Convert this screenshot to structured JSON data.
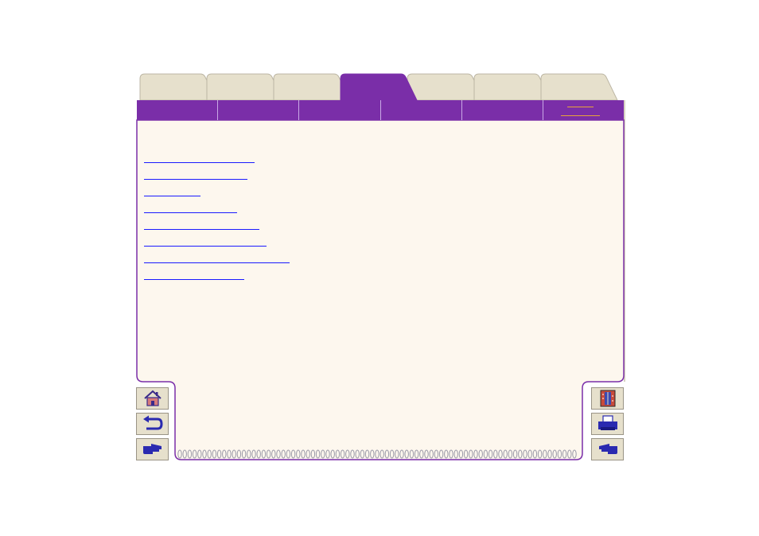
{
  "window": {
    "title": ""
  },
  "tabs": [
    {
      "label": "",
      "active": false
    },
    {
      "label": "",
      "active": false
    },
    {
      "label": "",
      "active": false
    },
    {
      "label": "",
      "active": true
    },
    {
      "label": "",
      "active": false
    },
    {
      "label": "",
      "active": false
    },
    {
      "label": "",
      "active": false
    }
  ],
  "subnav": [
    {
      "label": "",
      "active": false
    },
    {
      "label": "",
      "active": false
    },
    {
      "label": "",
      "active": false
    },
    {
      "label": "",
      "active": false
    },
    {
      "label": "",
      "active": false
    },
    {
      "label": "",
      "active": true
    }
  ],
  "links": [
    {
      "label": "",
      "underline_fraction": 0.76
    },
    {
      "label": "",
      "underline_fraction": 0.71
    },
    {
      "label": "",
      "underline_fraction": 0.39
    },
    {
      "label": "",
      "underline_fraction": 0.64
    },
    {
      "label": "",
      "underline_fraction": 0.79
    },
    {
      "label": "",
      "underline_fraction": 0.84
    },
    {
      "label": "",
      "underline_fraction": 1.0
    },
    {
      "label": "",
      "underline_fraction": 0.69
    }
  ],
  "nav_left": [
    {
      "icon": "home-icon"
    },
    {
      "icon": "back-arrow-icon"
    },
    {
      "icon": "hand-point-right-icon"
    }
  ],
  "nav_right": [
    {
      "icon": "book-index-icon"
    },
    {
      "icon": "printer-icon"
    },
    {
      "icon": "hand-point-left-icon"
    }
  ],
  "colors": {
    "purple": "#7a2ea8",
    "purple_dark": "#5a1f80",
    "page": "#fdf7ee",
    "tab_inactive": "#e6e0cc",
    "link": "#1a1aff",
    "active_underline": "#e8a33a"
  }
}
